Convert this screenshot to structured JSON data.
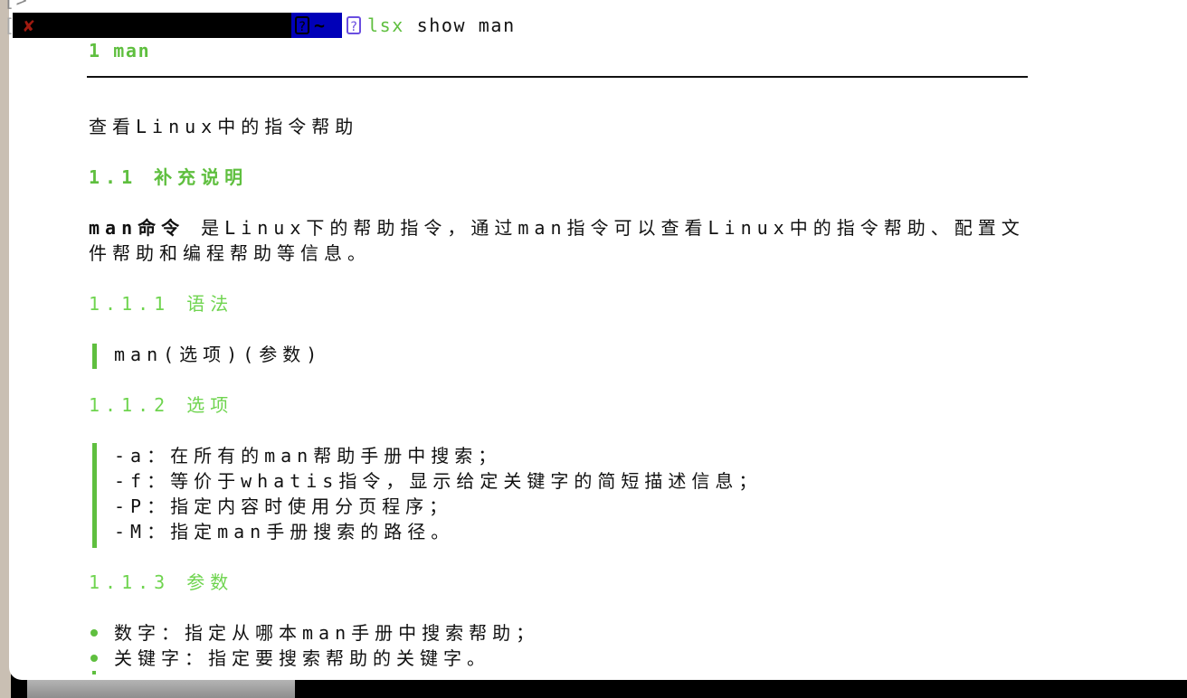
{
  "prompt": {
    "status_icon": "x-mark",
    "dir": "~",
    "command_name": "lsx",
    "command_args": " show man",
    "accent_blue": "#0000b8",
    "cmd_color": "#5fbf3f"
  },
  "doc": {
    "h1": "1 man",
    "intro": "查看Linux中的指令帮助",
    "h2": "1.1 补充说明",
    "para_bold": "man命令",
    "para_rest": " 是Linux下的帮助指令，通过man指令可以查看Linux中的指令帮助、配置文",
    "para_line2": "件帮助和编程帮助等信息。",
    "h3_syntax": "1.1.1 语法",
    "syntax": "man(选项)(参数)",
    "h3_options": "1.1.2 选项",
    "options": [
      "-a：在所有的man帮助手册中搜索；",
      "-f：等价于whatis指令，显示给定关键字的简短描述信息；",
      "-P：指定内容时使用分页程序；",
      "-M：指定man手册搜索的路径。"
    ],
    "h3_params": "1.1.3 参数",
    "params": [
      "数字：指定从哪本man手册中搜索帮助；",
      "关键字：指定要搜索帮助的关键字。"
    ]
  }
}
